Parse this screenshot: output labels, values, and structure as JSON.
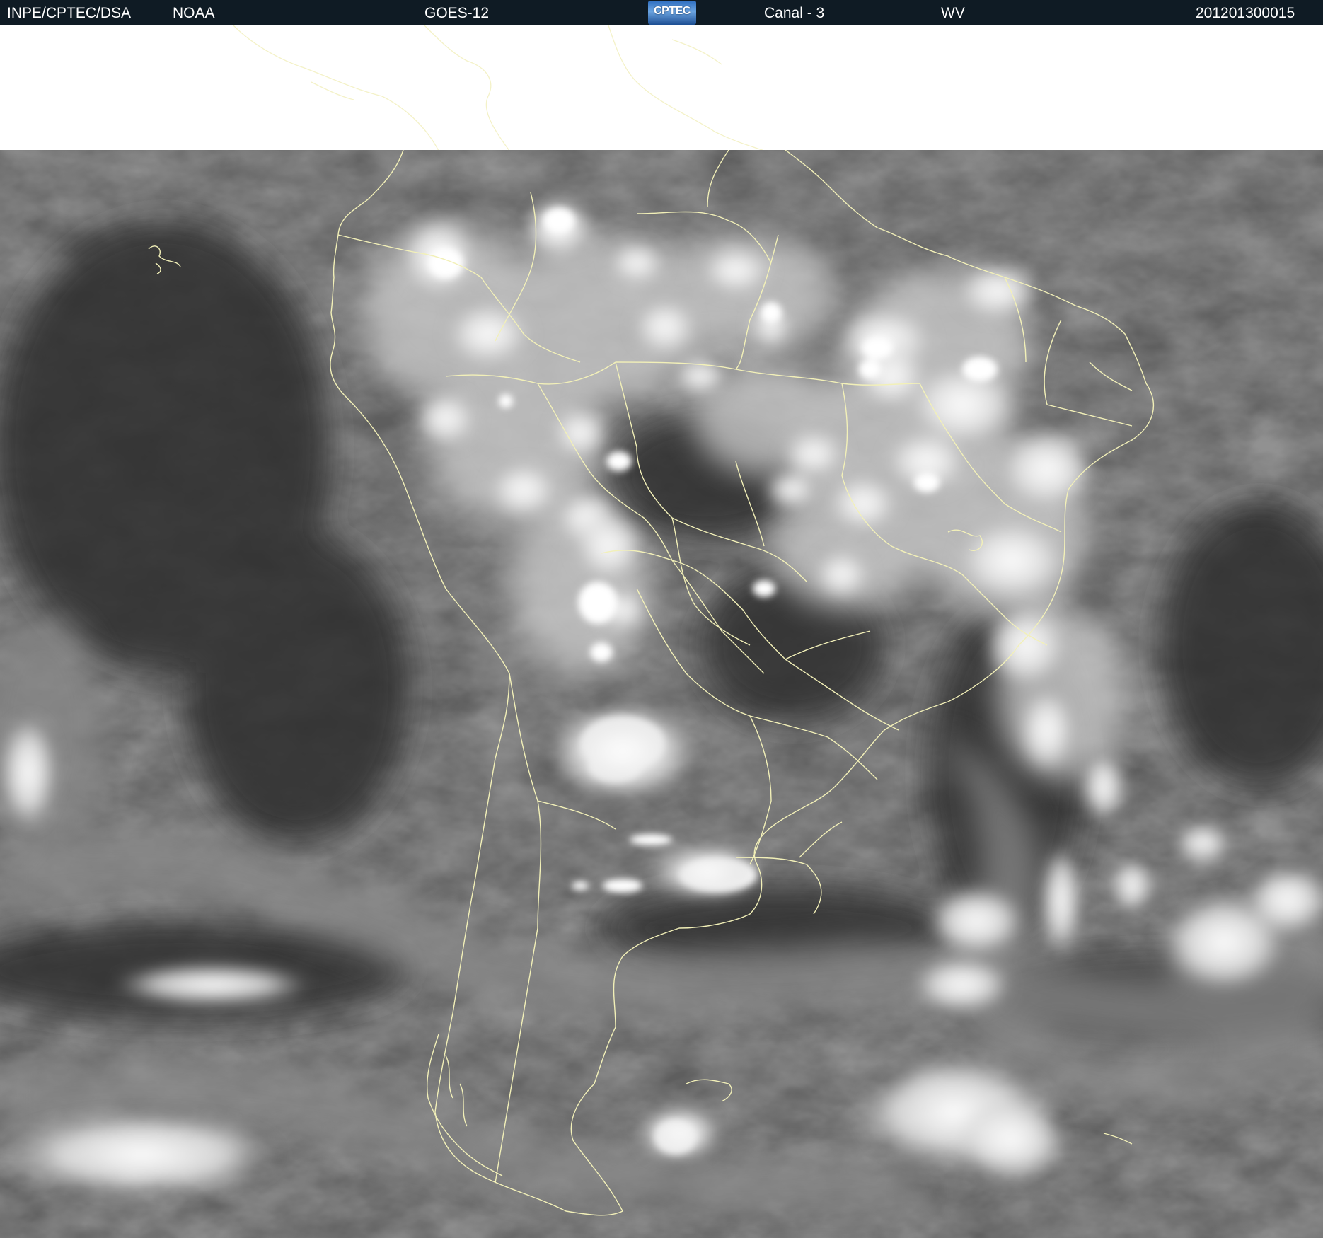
{
  "header": {
    "agency": "INPE/CPTEC/DSA",
    "partner": "NOAA",
    "satellite": "GOES-12",
    "logo_text": "CPTEC",
    "channel": "Canal - 3",
    "band": "WV",
    "timestamp": "201201300015",
    "background_color": "#0f1b24",
    "text_color": "#ffffff"
  },
  "image": {
    "content": "water-vapor-satellite-imagery",
    "region": "south-america",
    "border_color": "#f2f0b8"
  }
}
